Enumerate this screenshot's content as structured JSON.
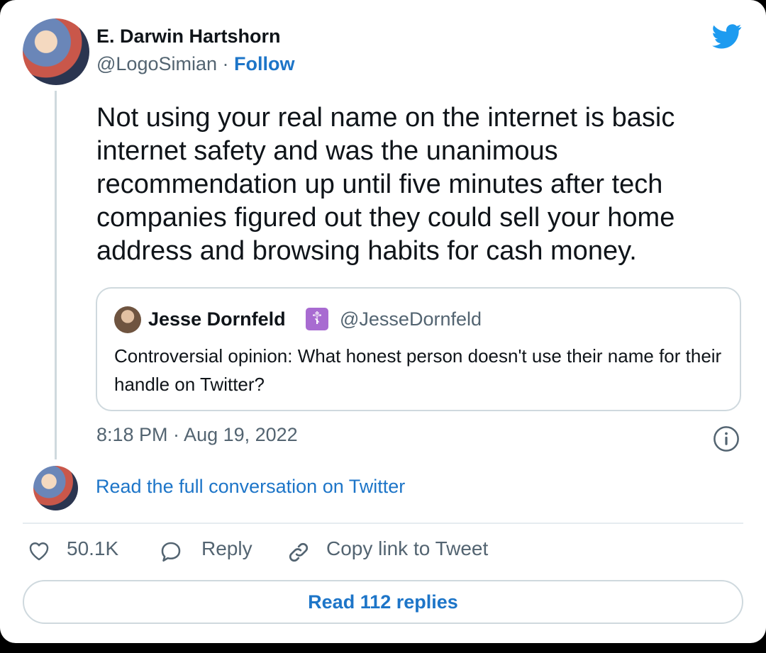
{
  "tweet": {
    "author_name": "E. Darwin Hartshorn",
    "handle": "@LogoSimian",
    "separator": " · ",
    "follow_label": "Follow",
    "text": "Not using your real name on the internet is basic internet safety and was the unanimous recommendation up until five minutes after tech companies figured out they could sell your home address and browsing habits for cash money.",
    "timestamp": "8:18 PM · Aug 19, 2022"
  },
  "quote": {
    "author_name": "Jesse Dornfeld",
    "badge_glyph": "☦",
    "handle": "@JesseDornfeld",
    "text": "Controversial opinion: What honest person doesn't use their name for their handle on Twitter?"
  },
  "read_full_label": "Read the full conversation on Twitter",
  "actions": {
    "likes_count": "50.1K",
    "reply_label": "Reply",
    "copy_link_label": "Copy link to Tweet"
  },
  "read_replies_label": "Read 112 replies",
  "icons": {
    "brand": "twitter-bird-icon",
    "like": "heart-icon",
    "reply": "reply-bubble-icon",
    "copy": "link-icon",
    "info": "info-icon"
  },
  "colors": {
    "link_blue": "#1d75c8",
    "twitter_blue": "#1d9bf0",
    "muted_text": "#536471",
    "border": "#cfd9de"
  }
}
